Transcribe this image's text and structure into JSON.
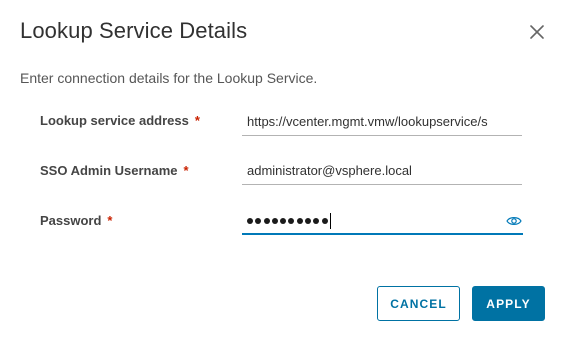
{
  "dialog": {
    "title": "Lookup Service Details",
    "subtitle": "Enter connection details for the Lookup Service.",
    "close_icon": "close-icon"
  },
  "form": {
    "required_marker": "*",
    "lookup_address": {
      "label": "Lookup service address",
      "value": "https://vcenter.mgmt.vmw/lookupservice/s"
    },
    "sso_username": {
      "label": "SSO Admin Username",
      "value": "administrator@vsphere.local"
    },
    "password": {
      "label": "Password",
      "masked_length": 10,
      "reveal_icon": "eye-icon"
    }
  },
  "actions": {
    "cancel_label": "CANCEL",
    "apply_label": "APPLY"
  },
  "colors": {
    "accent": "#0072a3",
    "required": "#c92100",
    "focus_underline": "#0079b8"
  }
}
